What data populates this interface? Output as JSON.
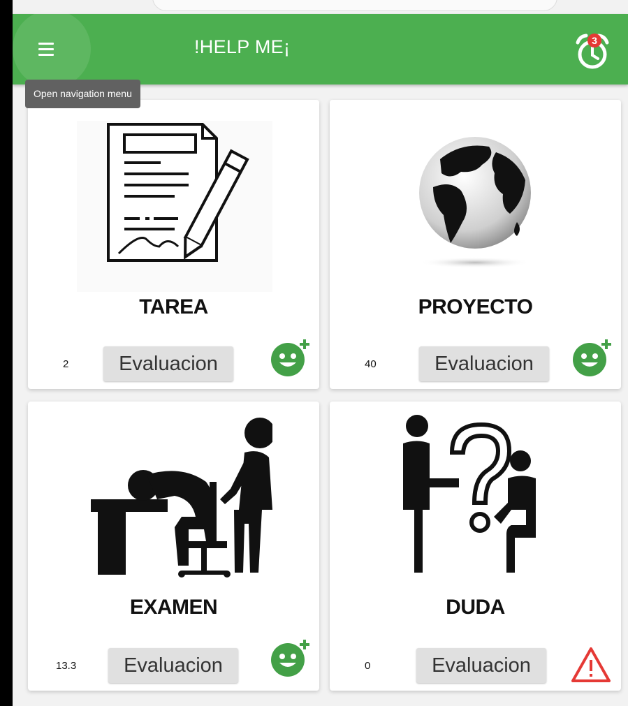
{
  "app": {
    "title": "!HELP ME¡",
    "alarm_badge": "3"
  },
  "tooltip": {
    "text": "Open navigation menu"
  },
  "cards": [
    {
      "label": "TAREA",
      "count": "2",
      "button": "Evaluacion",
      "status_icon": "add-smiley-icon"
    },
    {
      "label": "PROYECTO",
      "count": "40",
      "button": "Evaluacion",
      "status_icon": "add-smiley-icon"
    },
    {
      "label": "EXAMEN",
      "count": "13.3",
      "button": "Evaluacion",
      "status_icon": "add-smiley-icon"
    },
    {
      "label": "DUDA",
      "count": "0",
      "button": "Evaluacion",
      "status_icon": "warning-icon"
    }
  ],
  "colors": {
    "appbar": "#4caf50",
    "smiley": "#43a047",
    "warning": "#e53935",
    "badge": "#e53935"
  }
}
